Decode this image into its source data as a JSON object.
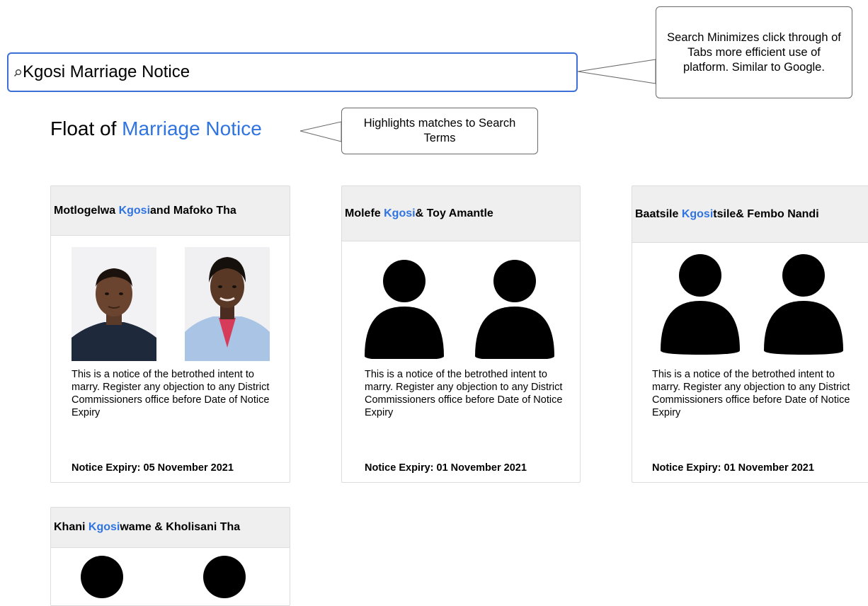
{
  "search": {
    "value": "Kgosi Marriage Notice"
  },
  "callouts": {
    "search_note": "Search Minimizes click through of Tabs more efficient use of platform. Similar to Google.",
    "highlight_note": "Highlights matches to Search Terms"
  },
  "page_title": {
    "prefix": "Float of ",
    "highlight": "Marriage Notice"
  },
  "notice_text": "This is a notice of the betrothed intent to marry. Register any objection to any District Commissioners office before Date of Notice Expiry",
  "cards": [
    {
      "name_before": "Motlogelwa ",
      "name_match": "Kgosi",
      "name_after": " and Mafoko Tha",
      "expiry": "Notice Expiry: 05 November 2021"
    },
    {
      "name_before": "Molefe ",
      "name_match": "Kgosi",
      "name_after": " & Toy Amantle",
      "expiry": "Notice Expiry: 01 November 2021"
    },
    {
      "name_before": "Baatsile ",
      "name_match": "Kgosi",
      "name_after": "tsile& Fembo Nandi",
      "expiry": "Notice Expiry: 01 November 2021"
    },
    {
      "name_before": "Khani ",
      "name_match": "Kgosi",
      "name_after": "wame & Kholisani Tha",
      "expiry": ""
    }
  ],
  "colors": {
    "highlight": "#2f74e0",
    "search_border": "#3d6fd8",
    "card_header_bg": "#efefef"
  },
  "icons": {
    "search": "magnifier-icon",
    "placeholder_person": "person-silhouette-icon"
  }
}
